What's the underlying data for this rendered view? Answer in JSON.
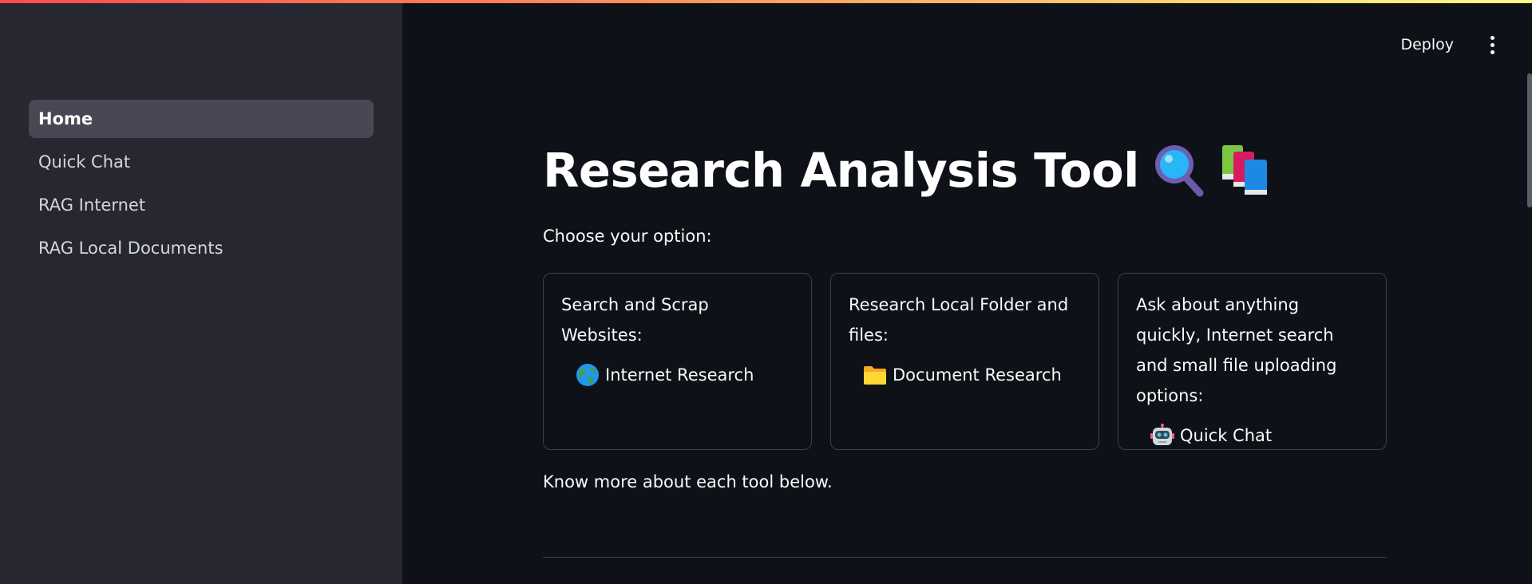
{
  "sidebar": {
    "items": [
      {
        "label": "Home",
        "active": true
      },
      {
        "label": "Quick Chat"
      },
      {
        "label": "RAG Internet"
      },
      {
        "label": "RAG Local Documents"
      }
    ]
  },
  "header": {
    "deploy_label": "Deploy",
    "menu_icon": "vertical-ellipsis-icon"
  },
  "main": {
    "title": "Research Analysis Tool",
    "title_icons": [
      "magnifier-icon",
      "books-icon"
    ],
    "choose_text": "Choose your option:",
    "cards": [
      {
        "text": "Search and Scrap Websites:",
        "link_label": "Internet Research",
        "link_icon": "globe-icon"
      },
      {
        "text": "Research Local Folder and files:",
        "link_label": "Document Research",
        "link_icon": "folder-icon"
      },
      {
        "text": "Ask about anything quickly, Internet search and small file uploading options:",
        "link_label": "Quick Chat",
        "link_icon": "robot-icon"
      }
    ],
    "know_more": "Know more about each tool below."
  },
  "colors": {
    "background": "#0e1117",
    "sidebar": "#262730",
    "sidebar_active": "#474853",
    "card_border": "#3d3f49",
    "accent_gradient_start": "#ff4b4b",
    "accent_gradient_end": "#fffd80"
  }
}
